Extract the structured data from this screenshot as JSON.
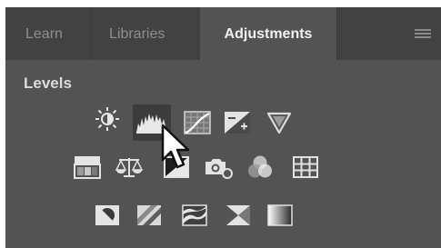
{
  "tabs": [
    {
      "label": "Learn"
    },
    {
      "label": "Libraries"
    },
    {
      "label": "Adjustments"
    }
  ],
  "active_tab": "Adjustments",
  "panel": {
    "title": "Levels"
  },
  "icon_rows": [
    [
      "brightness-contrast-icon",
      "levels-icon",
      "curves-icon",
      "exposure-icon",
      "vibrance-icon"
    ],
    [
      "hue-saturation-icon",
      "color-balance-icon",
      "black-white-icon",
      "photo-filter-icon",
      "channel-mixer-icon",
      "color-lookup-icon"
    ],
    [
      "invert-icon",
      "posterize-icon",
      "threshold-icon",
      "selective-color-icon",
      "gradient-map-icon"
    ]
  ],
  "hovered_icon": "levels-icon",
  "colors": {
    "panel_bg": "#535353",
    "tabbar_bg": "#424242",
    "icon_light": "#e0e0e0"
  }
}
